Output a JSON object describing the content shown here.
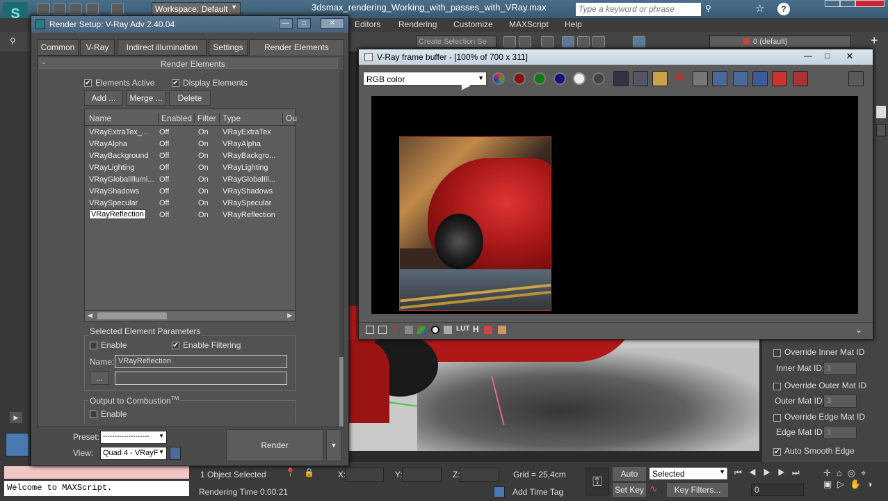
{
  "app": {
    "workspace_label": "Workspace: Default",
    "file_title": "3dsmax_rendering_Working_with_passes_with_VRay.max",
    "search_placeholder": "Type a keyword or phrase",
    "menu": [
      "Editors",
      "Rendering",
      "Customize",
      "MAXScript",
      "Help"
    ],
    "selection_set_placeholder": "Create Selection Se",
    "layer_label": "0 (default)"
  },
  "render_setup": {
    "title": "Render Setup: V-Ray Adv 2.40.04",
    "tabs": [
      "Common",
      "V-Ray",
      "Indirect illumination",
      "Settings",
      "Render Elements"
    ],
    "active_tab": "Render Elements",
    "rollout_title": "Render Elements",
    "rollout_toggle": "-",
    "elements_active": "Elements Active",
    "display_elements": "Display Elements",
    "add_button": "Add ...",
    "merge_button": "Merge ...",
    "delete_button": "Delete",
    "columns": [
      "Name",
      "Enabled",
      "Filter",
      "Type",
      "Ou"
    ],
    "rows": [
      {
        "name": "VRayExtraTex_...",
        "enabled": "Off",
        "filter": "On",
        "type": "VRayExtraTex"
      },
      {
        "name": "VRayAlpha",
        "enabled": "Off",
        "filter": "On",
        "type": "VRayAlpha"
      },
      {
        "name": "VRayBackground",
        "enabled": "Off",
        "filter": "On",
        "type": "VRayBackgro..."
      },
      {
        "name": "VRayLighting",
        "enabled": "Off",
        "filter": "On",
        "type": "VRayLighting"
      },
      {
        "name": "VRayGlobalIllumi...",
        "enabled": "Off",
        "filter": "On",
        "type": "VRayGlobalIll..."
      },
      {
        "name": "VRayShadows",
        "enabled": "Off",
        "filter": "On",
        "type": "VRayShadows"
      },
      {
        "name": "VRaySpecular",
        "enabled": "Off",
        "filter": "On",
        "type": "VRaySpecular"
      },
      {
        "name": "VRayReflection",
        "enabled": "Off",
        "filter": "On",
        "type": "VRayReflection"
      }
    ],
    "selected_row": "VRayReflection",
    "selected_params_title": "Selected Element Parameters",
    "enable_label": "Enable",
    "enable_filtering_label": "Enable Filtering",
    "name_label": "Name:",
    "name_value": "VRayReflection",
    "browse_button": "...",
    "output_combustion_title": "Output to Combustion",
    "output_combustion_tm": "TM",
    "output_enable_label": "Enable",
    "preset_label": "Preset:",
    "preset_value": "--------------------",
    "view_label": "View:",
    "view_value": "Quad 4 - VRayF",
    "render_button": "Render"
  },
  "frame_buffer": {
    "title": "V-Ray frame buffer - [100% of 700 x 311]",
    "channel": "RGB color"
  },
  "right_panel": {
    "override_inner": "Override Inner Mat ID",
    "inner_label": "Inner Mat ID:",
    "inner_value": "1",
    "override_outer": "Override Outer Mat ID",
    "outer_label": "Outer Mat ID:",
    "outer_value": "3",
    "override_edge": "Override Edge Mat ID",
    "edge_label": "Edge Mat ID:",
    "edge_value": "1",
    "auto_smooth": "Auto Smooth Edge"
  },
  "status": {
    "maxscript": "Welcome to MAXScript.",
    "selected_count": "1 Object Selected",
    "rendering_time": "Rendering Time  0:00:21",
    "x_label": "X:",
    "y_label": "Y:",
    "z_label": "Z:",
    "grid": "Grid = 25,4cm",
    "add_time_tag": "Add Time Tag",
    "auto_key": "Auto Key",
    "set_key": "Set Key",
    "selected_dropdown": "Selected",
    "key_filters": "Key Filters...",
    "frame": "0"
  }
}
